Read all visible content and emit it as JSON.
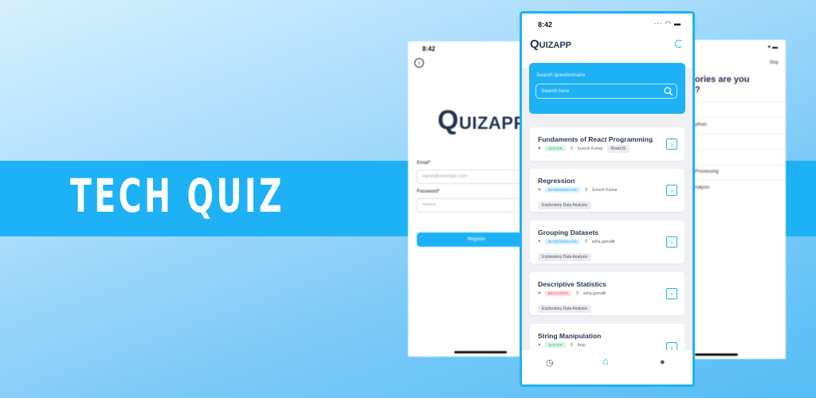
{
  "banner": {
    "title": "TECH QUIZ"
  },
  "colors": {
    "accent": "#1eb1f5",
    "logo": "#253451"
  },
  "register_screen": {
    "time": "8:42",
    "back_icon": "chevron-left-icon",
    "logo_initial": "Q",
    "logo_rest": "UIZAPP",
    "email_label": "Email*",
    "email_placeholder": "name@example.com",
    "password_label": "Password*",
    "password_placeholder": "••••••••",
    "register_label": "Register"
  },
  "categories_screen": {
    "skip": "Skip",
    "heading_line1": "ories are you",
    "heading_line2": "?",
    "items": [
      "ython",
      "Processing",
      "nalysis"
    ]
  },
  "main_screen": {
    "time": "8:42",
    "logo_initial": "Q",
    "logo_rest": "UIZAPP",
    "search_label": "Search questionnaire",
    "search_placeholder": "Search here",
    "quizzes": [
      {
        "title": "Fundaments of React Programming",
        "level": "JUNIOR",
        "author": "Suresh Kumar",
        "tag": "ReactJS"
      },
      {
        "title": "Regression",
        "level": "INTERMEDIATE",
        "author": "Suresh Kumar",
        "tag": "Exploratory Data Analysis"
      },
      {
        "title": "Grouping Datasets",
        "level": "INTERMEDIATE",
        "author": "asha.gurrallti",
        "tag": "Exploratory Data Analysis"
      },
      {
        "title": "Descriptive Statistics",
        "level": "BEGINNER",
        "author": "asha.gurrallti",
        "tag": "Exploratory Data Analysis"
      },
      {
        "title": "String Manipulation",
        "level": "JUNIOR",
        "author": "Anju",
        "tag": ""
      }
    ],
    "tabs": [
      "history-icon",
      "home-icon",
      "profile-icon"
    ]
  }
}
